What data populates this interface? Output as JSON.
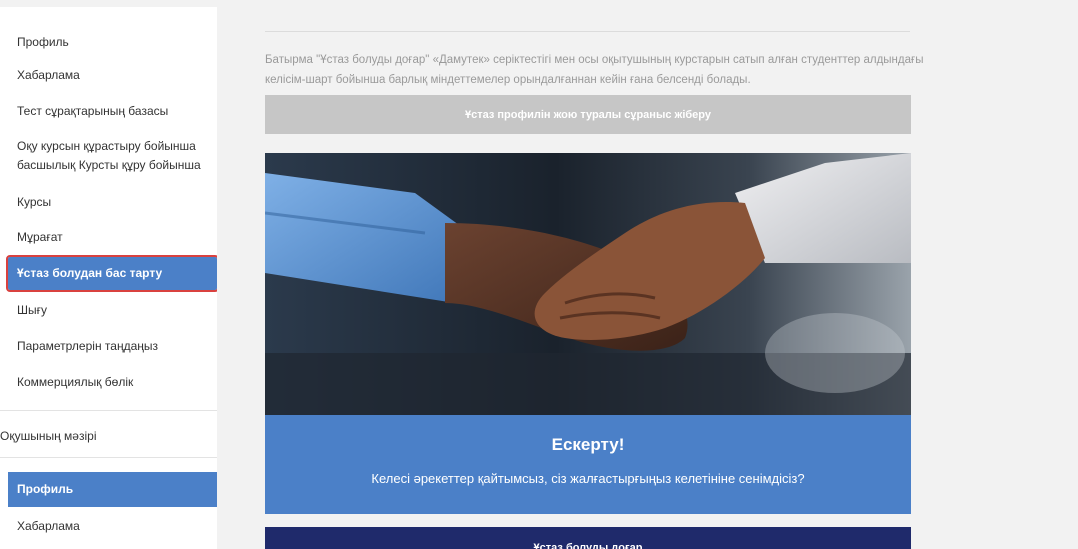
{
  "sidebar": {
    "teacher_menu": [
      {
        "label": "Профиль"
      },
      {
        "label": "Хабарлама"
      },
      {
        "label": "Тест сұрақтарының базасы"
      },
      {
        "label_line1": "Оқу курсын құрастыру бойынша",
        "label_line2": "басшылық Курсты құру бойынша"
      },
      {
        "label": "Курсы"
      },
      {
        "label": "Мұрағат"
      },
      {
        "label": "Ұстаз болудан бас тарту"
      },
      {
        "label": "Шығу"
      },
      {
        "label": "Параметрлерін таңдаңыз"
      },
      {
        "label": "Коммерциялық бөлік"
      }
    ],
    "student_section_title": "Оқушының мәзірі",
    "student_menu": [
      {
        "label": "Профиль"
      },
      {
        "label": "Хабарлама"
      }
    ]
  },
  "main": {
    "intro_text": "Батырма \"Ұстаз болуды доғар\" «Дамутек» серіктестігі мен осы оқытушының курстарын сатып алған студенттер алдындағы келісім-шарт бойынша барлық міндеттемелер орындалғаннан кейін ғана белсенді болады.",
    "request_button": "Ұстаз профилін жою туралы сұраныс жіберу",
    "photo_icon": "handshake-photo",
    "warning_title": "Ескерту!",
    "warning_text": "Келесі әрекеттер қайтымсыз, сіз жалғастырғыңыз келетініне сенімдісіз?",
    "confirm_button": "Ұстаз болуды доғар"
  },
  "colors": {
    "accent": "#4b80c8",
    "highlight_border": "#d9413f",
    "dark_button": "#1f2a6b",
    "disabled_button": "#c6c6c6"
  }
}
